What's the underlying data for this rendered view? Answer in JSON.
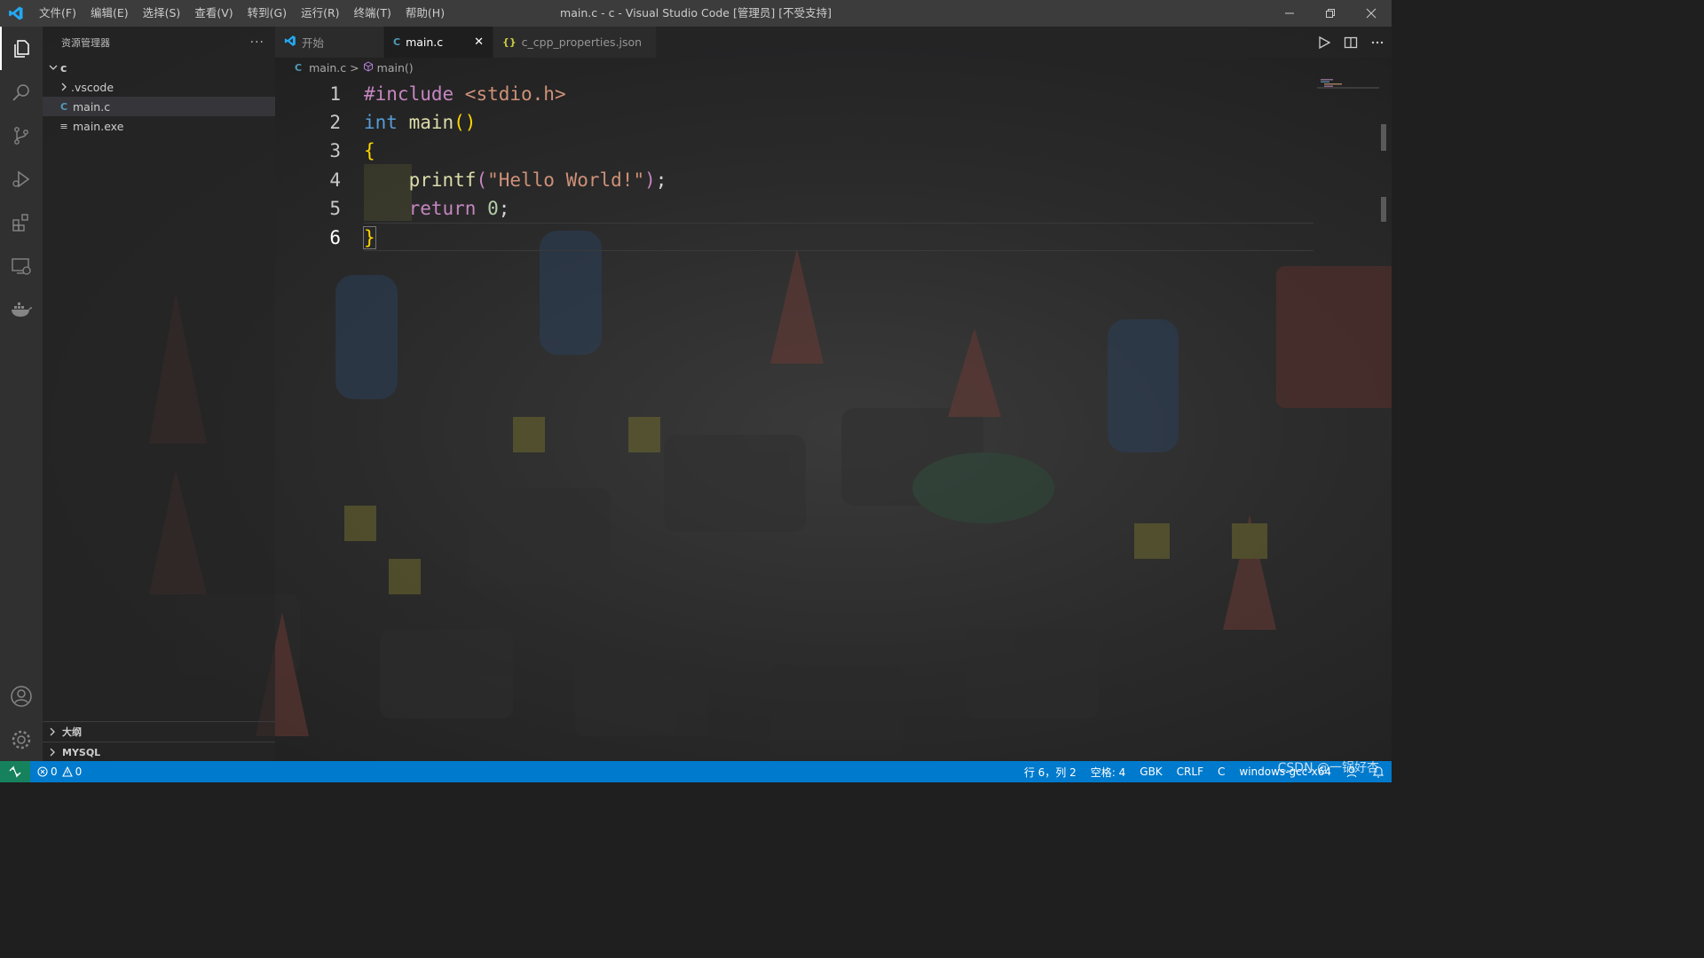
{
  "window": {
    "title": "main.c - c - Visual Studio Code [管理员] [不受支持]",
    "menu": [
      "文件(F)",
      "编辑(E)",
      "选择(S)",
      "查看(V)",
      "转到(G)",
      "运行(R)",
      "终端(T)",
      "帮助(H)"
    ]
  },
  "activity_bar": {
    "top": [
      "explorer-icon",
      "search-icon",
      "source-control-icon",
      "run-debug-icon",
      "extensions-icon",
      "remote-explorer-icon",
      "docker-icon"
    ],
    "bottom": [
      "account-icon",
      "settings-gear-icon"
    ]
  },
  "sidebar": {
    "header": "资源管理器",
    "more": "···",
    "root": "c",
    "items": [
      {
        "label": ".vscode",
        "kind": "folder"
      },
      {
        "label": "main.c",
        "kind": "c-file",
        "icon_text": "C"
      },
      {
        "label": "main.exe",
        "kind": "file",
        "icon_text": "≡"
      }
    ],
    "sections": [
      "大纲",
      "MYSQL"
    ]
  },
  "tabs": [
    {
      "label": "开始",
      "icon": "vscode-icon"
    },
    {
      "label": "main.c",
      "icon_text": "C",
      "active": true,
      "close": "✕"
    },
    {
      "label": "c_cpp_properties.json",
      "icon_text": "{}"
    }
  ],
  "breadcrumb": {
    "file_icon_text": "C",
    "file": "main.c",
    "sep": ">",
    "symbol": "main()"
  },
  "editor": {
    "line_numbers": [
      "1",
      "2",
      "3",
      "4",
      "5",
      "6"
    ],
    "lines": {
      "l1_directive": "#include",
      "l1_header": " <stdio.h>",
      "l2_type": "int",
      "l2_name": " main",
      "l2_parens": "()",
      "l3_open": "{",
      "l4_indent": "    ",
      "l4_fn": "printf",
      "l4_paren_open": "(",
      "l4_string": "\"Hello World!\"",
      "l4_paren_close": ")",
      "l4_semi": ";",
      "l5_indent": "    ",
      "l5_kw": "return",
      "l5_space": " ",
      "l5_num": "0",
      "l5_semi": ";",
      "l6_close": "}"
    }
  },
  "statusbar": {
    "errors": "0",
    "warnings": "0",
    "position": "行 6，列 2",
    "spaces": "空格: 4",
    "encoding": "GBK",
    "eol": "CRLF",
    "language": "C",
    "config": "windows-gcc-x64"
  },
  "watermark": "CSDN @一锅好杏",
  "colors": {
    "accent": "#007acc",
    "remote": "#16825d",
    "keyword": "#569cd6",
    "directive": "#c586c0",
    "string": "#ce9178",
    "function": "#dcdcaa",
    "number": "#b5cea8",
    "bracket": "#ffd700"
  }
}
